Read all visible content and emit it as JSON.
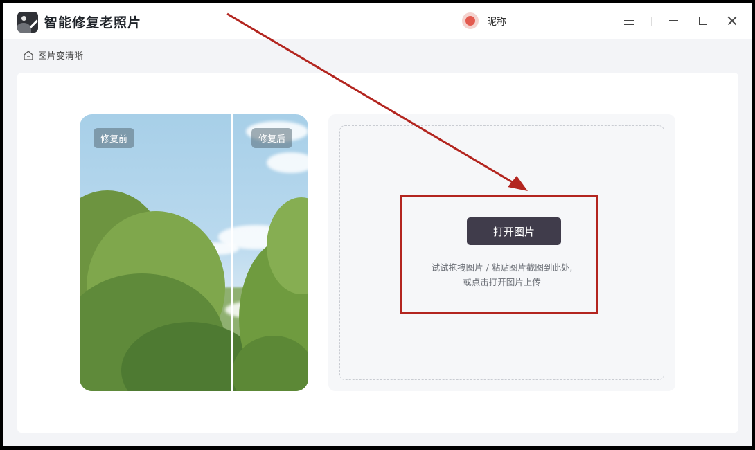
{
  "app": {
    "title": "智能修复老照片",
    "user_name": "昵称"
  },
  "window_controls": {
    "menu": "menu-icon",
    "minimize": "minimize-icon",
    "maximize": "maximize-icon",
    "close": "close-icon"
  },
  "breadcrumb": {
    "label": "图片变清晰"
  },
  "preview": {
    "before_label": "修复前",
    "after_label": "修复后"
  },
  "upload": {
    "button_label": "打开图片",
    "hint_line1": "试试拖拽图片 / 粘贴图片截图到此处,",
    "hint_line2": "或点击打开图片上传"
  },
  "colors": {
    "button_bg": "#403c4b",
    "annotation": "#b3251f",
    "window_bg": "#f3f4f7"
  }
}
